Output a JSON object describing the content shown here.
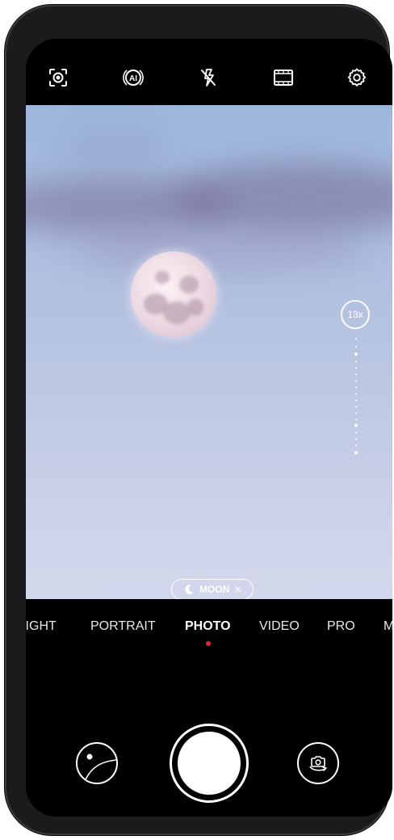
{
  "topbar": {
    "icons": [
      "aperture-mode-icon",
      "ai-icon",
      "flash-off-icon",
      "film-ratio-icon",
      "settings-gear-icon"
    ]
  },
  "viewfinder": {
    "zoom_label": "13x",
    "scene_label": "MOON",
    "scene_close": "×"
  },
  "modes": {
    "items": [
      {
        "label": "NIGHT",
        "active": false
      },
      {
        "label": "PORTRAIT",
        "active": false
      },
      {
        "label": "PHOTO",
        "active": true
      },
      {
        "label": "VIDEO",
        "active": false
      },
      {
        "label": "PRO",
        "active": false
      },
      {
        "label": "MORE",
        "active": false
      }
    ]
  },
  "controls": {
    "gallery": "gallery-thumbnail",
    "shutter": "shutter-button",
    "flip": "switch-camera-icon"
  },
  "colors": {
    "accent_dot": "#e5242b",
    "foreground": "#ffffff",
    "background": "#000000"
  }
}
